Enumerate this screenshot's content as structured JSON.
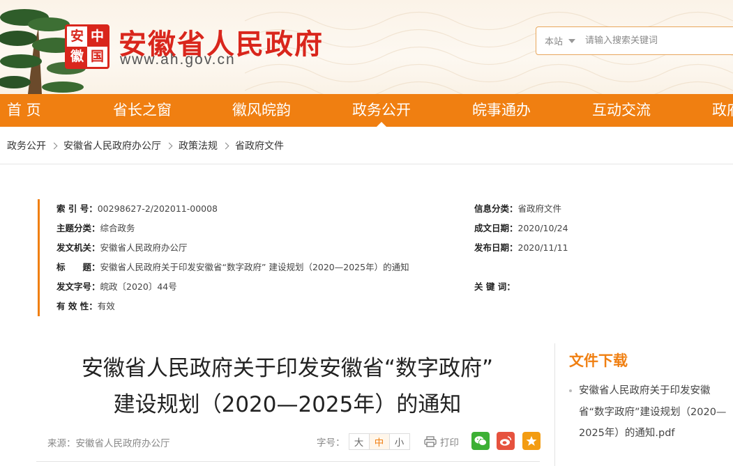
{
  "header": {
    "seal_chars": [
      "安",
      "中",
      "徽",
      "国"
    ],
    "site_title": "安徽省人民政府",
    "site_url": "www.ah.gov.cn",
    "search": {
      "scope": "本站",
      "placeholder": "请输入搜索关键词"
    }
  },
  "nav": {
    "items": [
      "首 页",
      "省长之窗",
      "徽风皖韵",
      "政务公开",
      "皖事通办",
      "互动交流",
      "政府"
    ],
    "active": "政务公开"
  },
  "breadcrumb": [
    "政务公开",
    "安徽省人民政府办公厅",
    "政策法规",
    "省政府文件"
  ],
  "info": {
    "index_no": {
      "label": "索 引 号：",
      "value": "00298627-2/202011-00008"
    },
    "category": {
      "label": "信息分类：",
      "value": "省政府文件"
    },
    "topic": {
      "label": "主题分类：",
      "value": "综合政务"
    },
    "created": {
      "label": "成文日期：",
      "value": "2020/10/24"
    },
    "issuer": {
      "label": "发文机关：",
      "value": "安徽省人民政府办公厅"
    },
    "published": {
      "label": "发布日期：",
      "value": "2020/11/11"
    },
    "title": {
      "label": "标　　题：",
      "value": "安徽省人民政府关于印发安徽省“数字政府” 建设规划（2020—2025年）的通知"
    },
    "doc_no": {
      "label": "发文字号：",
      "value": "皖政〔2020〕44号"
    },
    "keywords": {
      "label": "关 键 词：",
      "value": ""
    },
    "validity": {
      "label": "有 效 性：",
      "value": "有效"
    }
  },
  "article": {
    "title_line1": "安徽省人民政府关于印发安徽省“数字政府”",
    "title_line2": "建设规划（2020—2025年）的通知",
    "source": "来源：安徽省人民政府办公厅",
    "font_size_label": "字号：",
    "font_sizes": [
      "大",
      "中",
      "小"
    ],
    "font_size_selected": "中",
    "print_label": "打印"
  },
  "download": {
    "title": "文件下载",
    "file_name": "安徽省人民政府关于印发安徽省“数字政府”建设规划（2020—2025年）的通知.pdf"
  },
  "colors": {
    "accent": "#f07f11",
    "brand_red": "#d9261c",
    "wechat": "#3cb034",
    "weibo": "#e6523e",
    "favorite": "#f39c12"
  }
}
